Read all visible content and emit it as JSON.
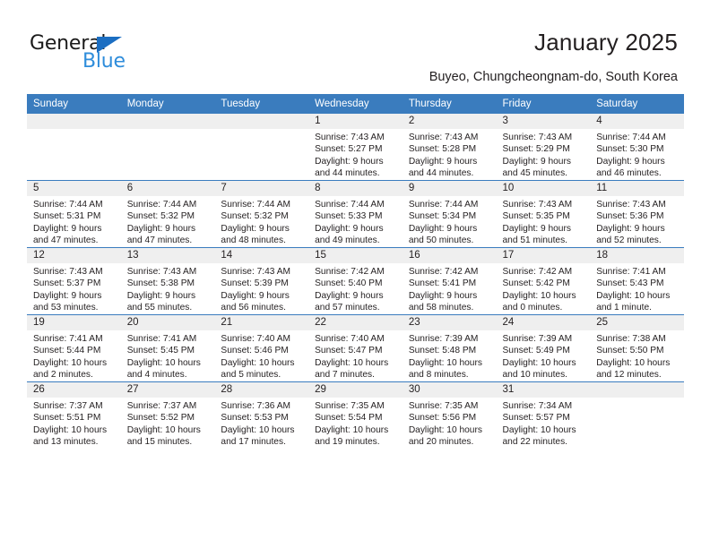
{
  "logo": {
    "word1": "General",
    "word2": "Blue",
    "triangle_color": "#1b6ec2",
    "blue_color": "#2f8ddb"
  },
  "header": {
    "title": "January 2025",
    "subtitle": "Buyeo, Chungcheongnam-do, South Korea"
  },
  "theme": {
    "header_bg": "#3a7cbe",
    "header_text": "#ffffff",
    "daynum_bg": "#efefef",
    "cell_bg": "#ffffff",
    "text": "#231f20"
  },
  "calendar": {
    "weekday_headers": [
      "Sunday",
      "Monday",
      "Tuesday",
      "Wednesday",
      "Thursday",
      "Friday",
      "Saturday"
    ],
    "weeks": [
      [
        {
          "day": "",
          "lines": []
        },
        {
          "day": "",
          "lines": []
        },
        {
          "day": "",
          "lines": []
        },
        {
          "day": "1",
          "lines": [
            "Sunrise: 7:43 AM",
            "Sunset: 5:27 PM",
            "Daylight: 9 hours",
            "and 44 minutes."
          ]
        },
        {
          "day": "2",
          "lines": [
            "Sunrise: 7:43 AM",
            "Sunset: 5:28 PM",
            "Daylight: 9 hours",
            "and 44 minutes."
          ]
        },
        {
          "day": "3",
          "lines": [
            "Sunrise: 7:43 AM",
            "Sunset: 5:29 PM",
            "Daylight: 9 hours",
            "and 45 minutes."
          ]
        },
        {
          "day": "4",
          "lines": [
            "Sunrise: 7:44 AM",
            "Sunset: 5:30 PM",
            "Daylight: 9 hours",
            "and 46 minutes."
          ]
        }
      ],
      [
        {
          "day": "5",
          "lines": [
            "Sunrise: 7:44 AM",
            "Sunset: 5:31 PM",
            "Daylight: 9 hours",
            "and 47 minutes."
          ]
        },
        {
          "day": "6",
          "lines": [
            "Sunrise: 7:44 AM",
            "Sunset: 5:32 PM",
            "Daylight: 9 hours",
            "and 47 minutes."
          ]
        },
        {
          "day": "7",
          "lines": [
            "Sunrise: 7:44 AM",
            "Sunset: 5:32 PM",
            "Daylight: 9 hours",
            "and 48 minutes."
          ]
        },
        {
          "day": "8",
          "lines": [
            "Sunrise: 7:44 AM",
            "Sunset: 5:33 PM",
            "Daylight: 9 hours",
            "and 49 minutes."
          ]
        },
        {
          "day": "9",
          "lines": [
            "Sunrise: 7:44 AM",
            "Sunset: 5:34 PM",
            "Daylight: 9 hours",
            "and 50 minutes."
          ]
        },
        {
          "day": "10",
          "lines": [
            "Sunrise: 7:43 AM",
            "Sunset: 5:35 PM",
            "Daylight: 9 hours",
            "and 51 minutes."
          ]
        },
        {
          "day": "11",
          "lines": [
            "Sunrise: 7:43 AM",
            "Sunset: 5:36 PM",
            "Daylight: 9 hours",
            "and 52 minutes."
          ]
        }
      ],
      [
        {
          "day": "12",
          "lines": [
            "Sunrise: 7:43 AM",
            "Sunset: 5:37 PM",
            "Daylight: 9 hours",
            "and 53 minutes."
          ]
        },
        {
          "day": "13",
          "lines": [
            "Sunrise: 7:43 AM",
            "Sunset: 5:38 PM",
            "Daylight: 9 hours",
            "and 55 minutes."
          ]
        },
        {
          "day": "14",
          "lines": [
            "Sunrise: 7:43 AM",
            "Sunset: 5:39 PM",
            "Daylight: 9 hours",
            "and 56 minutes."
          ]
        },
        {
          "day": "15",
          "lines": [
            "Sunrise: 7:42 AM",
            "Sunset: 5:40 PM",
            "Daylight: 9 hours",
            "and 57 minutes."
          ]
        },
        {
          "day": "16",
          "lines": [
            "Sunrise: 7:42 AM",
            "Sunset: 5:41 PM",
            "Daylight: 9 hours",
            "and 58 minutes."
          ]
        },
        {
          "day": "17",
          "lines": [
            "Sunrise: 7:42 AM",
            "Sunset: 5:42 PM",
            "Daylight: 10 hours",
            "and 0 minutes."
          ]
        },
        {
          "day": "18",
          "lines": [
            "Sunrise: 7:41 AM",
            "Sunset: 5:43 PM",
            "Daylight: 10 hours",
            "and 1 minute."
          ]
        }
      ],
      [
        {
          "day": "19",
          "lines": [
            "Sunrise: 7:41 AM",
            "Sunset: 5:44 PM",
            "Daylight: 10 hours",
            "and 2 minutes."
          ]
        },
        {
          "day": "20",
          "lines": [
            "Sunrise: 7:41 AM",
            "Sunset: 5:45 PM",
            "Daylight: 10 hours",
            "and 4 minutes."
          ]
        },
        {
          "day": "21",
          "lines": [
            "Sunrise: 7:40 AM",
            "Sunset: 5:46 PM",
            "Daylight: 10 hours",
            "and 5 minutes."
          ]
        },
        {
          "day": "22",
          "lines": [
            "Sunrise: 7:40 AM",
            "Sunset: 5:47 PM",
            "Daylight: 10 hours",
            "and 7 minutes."
          ]
        },
        {
          "day": "23",
          "lines": [
            "Sunrise: 7:39 AM",
            "Sunset: 5:48 PM",
            "Daylight: 10 hours",
            "and 8 minutes."
          ]
        },
        {
          "day": "24",
          "lines": [
            "Sunrise: 7:39 AM",
            "Sunset: 5:49 PM",
            "Daylight: 10 hours",
            "and 10 minutes."
          ]
        },
        {
          "day": "25",
          "lines": [
            "Sunrise: 7:38 AM",
            "Sunset: 5:50 PM",
            "Daylight: 10 hours",
            "and 12 minutes."
          ]
        }
      ],
      [
        {
          "day": "26",
          "lines": [
            "Sunrise: 7:37 AM",
            "Sunset: 5:51 PM",
            "Daylight: 10 hours",
            "and 13 minutes."
          ]
        },
        {
          "day": "27",
          "lines": [
            "Sunrise: 7:37 AM",
            "Sunset: 5:52 PM",
            "Daylight: 10 hours",
            "and 15 minutes."
          ]
        },
        {
          "day": "28",
          "lines": [
            "Sunrise: 7:36 AM",
            "Sunset: 5:53 PM",
            "Daylight: 10 hours",
            "and 17 minutes."
          ]
        },
        {
          "day": "29",
          "lines": [
            "Sunrise: 7:35 AM",
            "Sunset: 5:54 PM",
            "Daylight: 10 hours",
            "and 19 minutes."
          ]
        },
        {
          "day": "30",
          "lines": [
            "Sunrise: 7:35 AM",
            "Sunset: 5:56 PM",
            "Daylight: 10 hours",
            "and 20 minutes."
          ]
        },
        {
          "day": "31",
          "lines": [
            "Sunrise: 7:34 AM",
            "Sunset: 5:57 PM",
            "Daylight: 10 hours",
            "and 22 minutes."
          ]
        },
        {
          "day": "",
          "lines": []
        }
      ]
    ]
  }
}
